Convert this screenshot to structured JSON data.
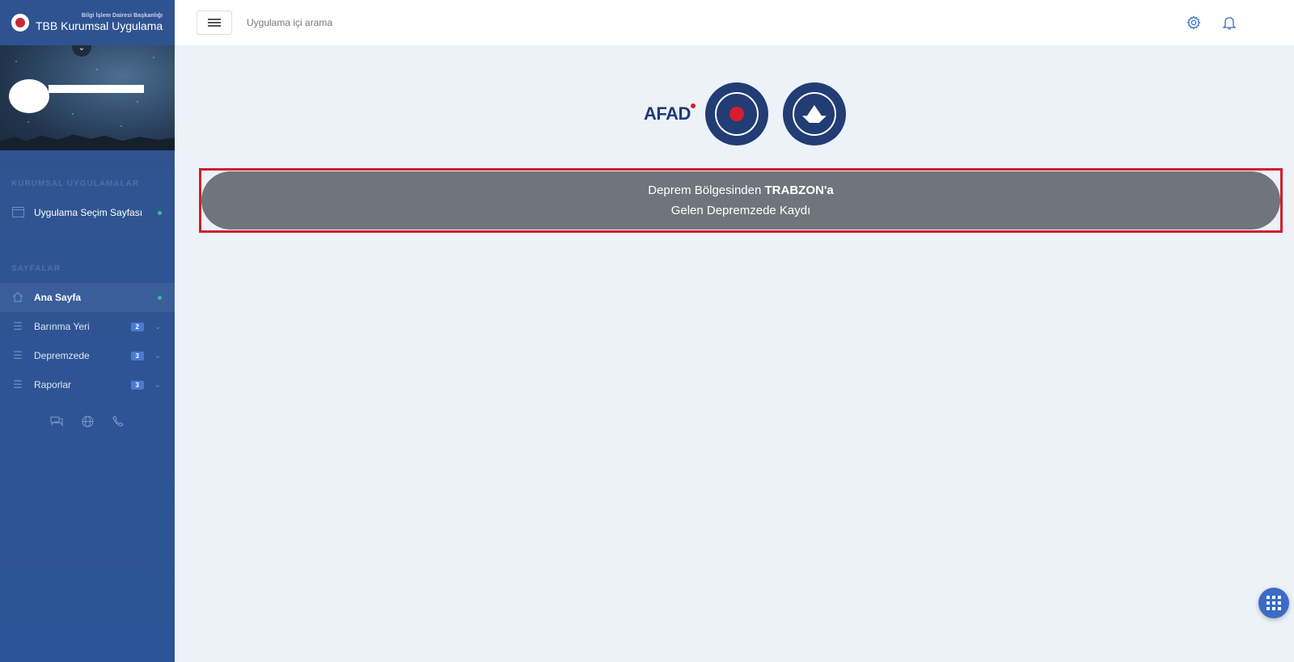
{
  "brand": {
    "subtitle": "Bilgi İşlem Dairesi Başkanlığı",
    "title": "TBB Kurumsal Uygulama"
  },
  "sidebar": {
    "sections": [
      {
        "title": "KURUMSAL UYGULAMALAR",
        "items": [
          {
            "label": "Uygulama Seçim Sayfası",
            "icon": "window-icon"
          }
        ]
      },
      {
        "title": "SAYFALAR",
        "items": [
          {
            "label": "Ana Sayfa",
            "icon": "home-icon"
          },
          {
            "label": "Barınma Yeri",
            "badge": "2",
            "icon": "menu-icon"
          },
          {
            "label": "Depremzede",
            "badge": "3",
            "icon": "menu-icon"
          },
          {
            "label": "Raporlar",
            "badge": "3",
            "icon": "menu-icon"
          }
        ]
      }
    ],
    "quick_icons": [
      "chat-icon",
      "globe-icon",
      "phone-icon"
    ]
  },
  "header": {
    "search_placeholder": "Uygulama içi arama",
    "icons": [
      "settings-icon",
      "bell-icon"
    ]
  },
  "main": {
    "logos": {
      "afad_text": "AFAD"
    },
    "banner": {
      "line1_prefix": "Deprem Bölgesinden ",
      "line1_bold": "TRABZON'a",
      "line2": "Gelen Depremzede Kaydı"
    }
  },
  "colors": {
    "sidebar_bg": "#2f5494",
    "accent": "#3a6cc6",
    "banner_bg": "#6e757c",
    "highlight_border": "#d0202b",
    "status_dot": "#28c88a"
  }
}
